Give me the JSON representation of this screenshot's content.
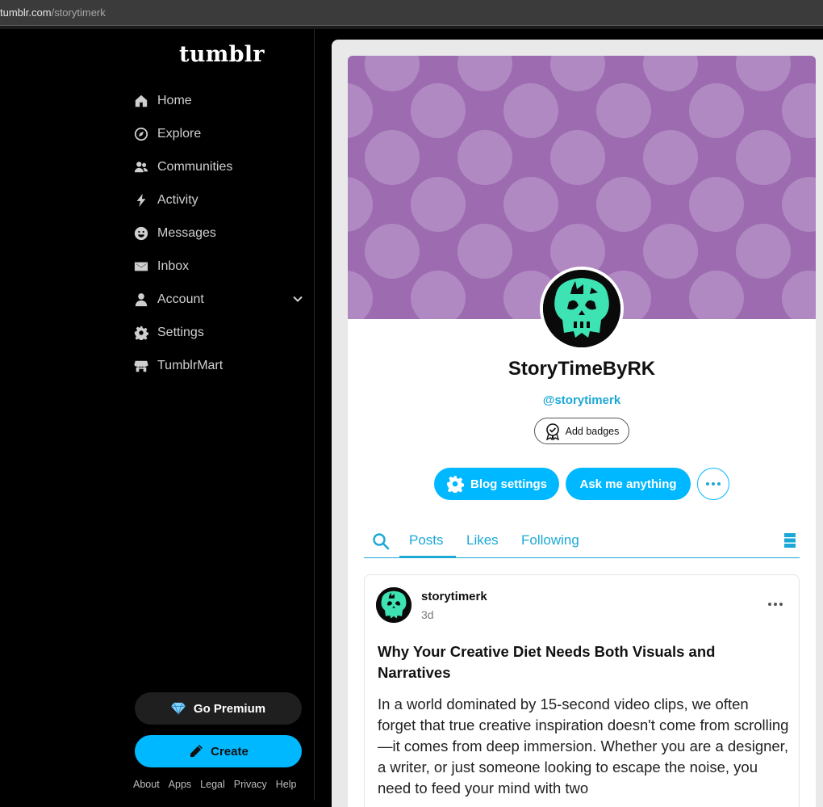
{
  "browser": {
    "url_main": "tumblr.com",
    "url_path": "/storytimerk"
  },
  "sidebar": {
    "logo": "tumblr",
    "items": [
      {
        "label": "Home",
        "icon": "home-icon"
      },
      {
        "label": "Explore",
        "icon": "compass-icon"
      },
      {
        "label": "Communities",
        "icon": "people-icon"
      },
      {
        "label": "Activity",
        "icon": "lightning-icon"
      },
      {
        "label": "Messages",
        "icon": "smiley-icon"
      },
      {
        "label": "Inbox",
        "icon": "envelope-icon"
      },
      {
        "label": "Account",
        "icon": "person-icon"
      },
      {
        "label": "Settings",
        "icon": "gear-icon"
      },
      {
        "label": "TumblrMart",
        "icon": "shop-icon"
      }
    ],
    "premium_label": "Go Premium",
    "create_label": "Create",
    "footer": [
      "About",
      "Apps",
      "Legal",
      "Privacy",
      "Help"
    ]
  },
  "blog": {
    "title": "StoryTimeByRK",
    "handle": "@storytimerk",
    "badges_label": "Add badges",
    "settings_label": "Blog settings",
    "ask_label": "Ask me anything",
    "header_color": "#9d6bb0",
    "accent_color": "#00b8ff"
  },
  "tabs": {
    "posts": "Posts",
    "likes": "Likes",
    "following": "Following"
  },
  "post": {
    "username": "storytimerk",
    "time": "3d",
    "title": "Why Your Creative Diet Needs Both Visuals and Narratives",
    "body": "In a world dominated by 15-second video clips, we often forget that true creative inspiration doesn't come from scrolling—it comes from deep immersion. Whether you are a designer, a writer, or just someone looking to escape the noise, you need to feed your mind with two"
  }
}
